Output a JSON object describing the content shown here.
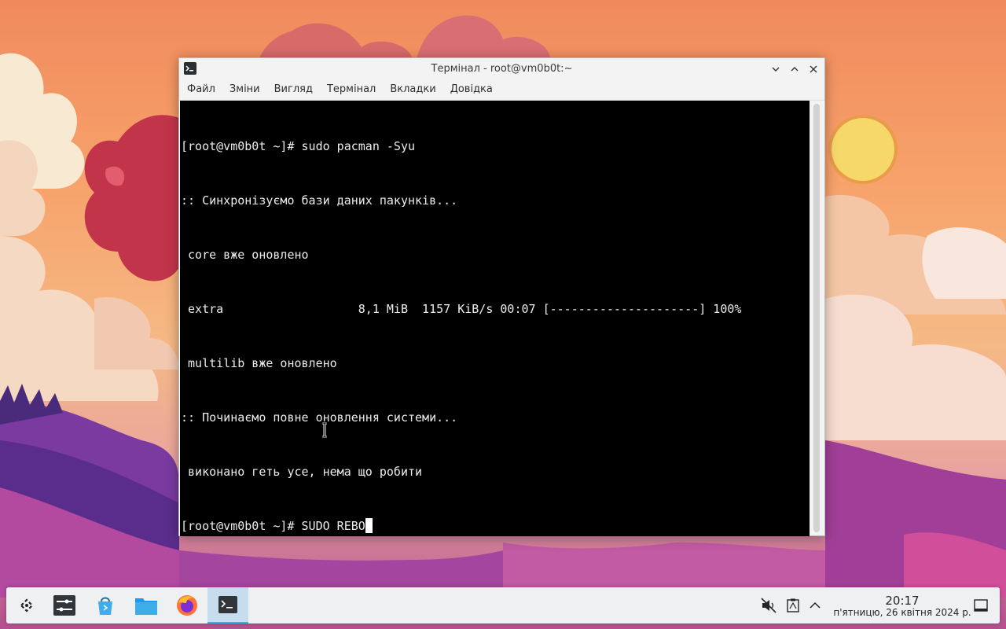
{
  "window": {
    "title": "Термінал - root@vm0b0t:~",
    "menu": [
      "Файл",
      "Зміни",
      "Вигляд",
      "Термінал",
      "Вкладки",
      "Довідка"
    ]
  },
  "terminal": {
    "lines": [
      "[root@vm0b0t ~]# sudo pacman -Syu",
      ":: Синхронізуємо бази даних пакунків...",
      " core вже оновлено",
      " extra                   8,1 MiB  1157 KiB/s 00:07 [---------------------] 100%",
      " multilib вже оновлено",
      ":: Починаємо повне оновлення системи...",
      " виконано геть усе, нема що робити"
    ],
    "prompt": "[root@vm0b0t ~]# ",
    "current_input": "SUDO REBO"
  },
  "taskbar": {
    "apps": [
      "launcher-icon",
      "settings-icon",
      "software-store-icon",
      "file-manager-icon",
      "firefox-icon",
      "terminal-icon"
    ],
    "tray": [
      "audio-muted-icon",
      "clipboard-icon",
      "tray-expand-icon"
    ],
    "time": "20:17",
    "date": "п'ятницю, 26 квітня 2024 р."
  },
  "colors": {
    "accent": "#3daee9",
    "terminal_bg": "#000000",
    "terminal_fg": "#ececec"
  }
}
